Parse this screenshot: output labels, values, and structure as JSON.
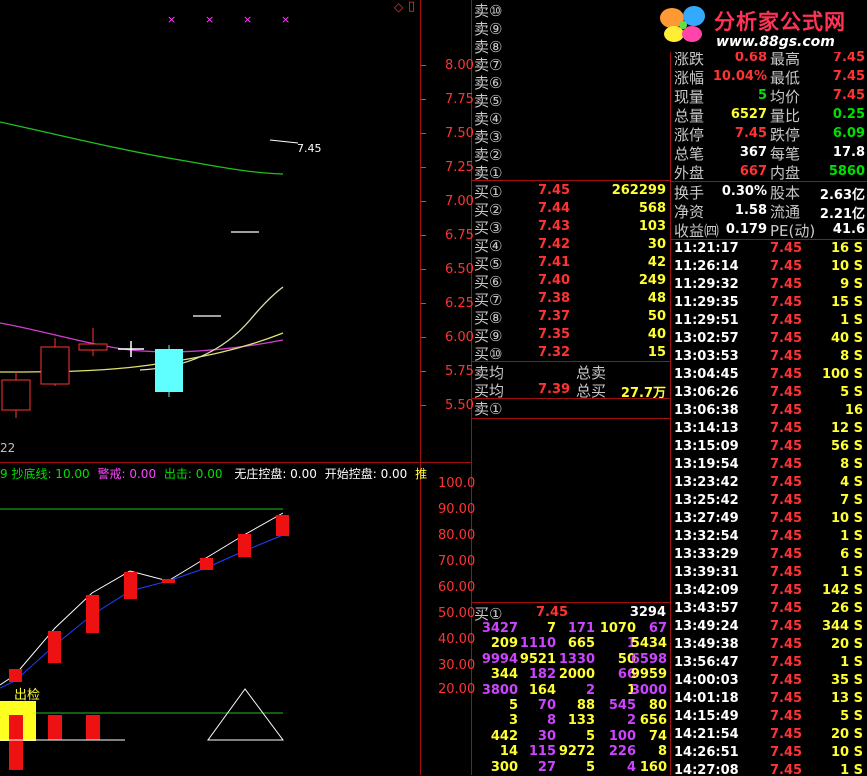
{
  "logo": {
    "title": "分析家公式网",
    "url": "www.88gs.com"
  },
  "chart_data": [
    {
      "type": "candlestick",
      "last_price_label": "7.45",
      "bottom_label": "22",
      "y_ticks": [
        "8.00",
        "7.75",
        "7.50",
        "7.25",
        "7.00",
        "6.75",
        "6.50",
        "6.25",
        "6.00",
        "5.75",
        "5.50"
      ],
      "marker_glyphs": [
        "×",
        "×",
        "×",
        "×"
      ],
      "top_symbols": [
        "◇",
        "▯"
      ]
    },
    {
      "type": "bar",
      "indicator_strip": [
        {
          "text": "9 抄底线: 10.00",
          "color": "#00e000"
        },
        {
          "text": "警戒: 0.00",
          "color": "#ff44ff"
        },
        {
          "text": "出击: 0.00",
          "color": "#00e000"
        },
        {
          "text": "无庄控盘: 0.00",
          "color": "#ffffff"
        },
        {
          "text": "开始控盘: 0.00",
          "color": "#ffffff"
        },
        {
          "text": "推",
          "color": "#ffff33"
        }
      ],
      "y_ticks": [
        "100.0",
        "90.00",
        "80.00",
        "70.00",
        "60.00",
        "50.00",
        "40.00",
        "30.00",
        "20.00"
      ],
      "annotation": "出检"
    }
  ],
  "sell_orders": [
    {
      "label": "卖⑩"
    },
    {
      "label": "卖⑨"
    },
    {
      "label": "卖⑧"
    },
    {
      "label": "卖⑦"
    },
    {
      "label": "卖⑥"
    },
    {
      "label": "卖⑤"
    },
    {
      "label": "卖④"
    },
    {
      "label": "卖③"
    },
    {
      "label": "卖②"
    },
    {
      "label": "卖①"
    }
  ],
  "buy_orders": [
    {
      "label": "买①",
      "price": "7.45",
      "vol": "262299"
    },
    {
      "label": "买②",
      "price": "7.44",
      "vol": "568"
    },
    {
      "label": "买③",
      "price": "7.43",
      "vol": "103"
    },
    {
      "label": "买④",
      "price": "7.42",
      "vol": "30"
    },
    {
      "label": "买⑤",
      "price": "7.41",
      "vol": "42"
    },
    {
      "label": "买⑥",
      "price": "7.40",
      "vol": "249"
    },
    {
      "label": "买⑦",
      "price": "7.38",
      "vol": "48"
    },
    {
      "label": "买⑧",
      "price": "7.37",
      "vol": "50"
    },
    {
      "label": "买⑨",
      "price": "7.35",
      "vol": "40"
    },
    {
      "label": "买⑩",
      "price": "7.32",
      "vol": "15"
    }
  ],
  "averages": {
    "sell_avg_label": "卖均",
    "total_sell_label": "总卖",
    "buy_avg_label": "买均",
    "buy_avg": "7.39",
    "total_buy_label": "总买",
    "total_buy": "27.7万",
    "sell1_label": "卖①"
  },
  "queue": {
    "label": "买①",
    "price": "7.45",
    "vol": "3294",
    "rows": [
      [
        "3427",
        "7",
        "171",
        "1070",
        "67"
      ],
      [
        "209",
        "1110",
        "665",
        "1",
        "5434"
      ],
      [
        "9994",
        "9521",
        "1330",
        "50",
        "6598"
      ],
      [
        "344",
        "182",
        "2000",
        "66",
        "9959"
      ],
      [
        "3800",
        "164",
        "2",
        "1",
        "3000"
      ],
      [
        "5",
        "70",
        "88",
        "545",
        "80"
      ],
      [
        "3",
        "8",
        "133",
        "2",
        "656"
      ],
      [
        "442",
        "30",
        "5",
        "100",
        "74"
      ],
      [
        "14",
        "115",
        "9272",
        "226",
        "8"
      ],
      [
        "300",
        "27",
        "5",
        "4",
        "160"
      ]
    ]
  },
  "quote": [
    {
      "l1": "涨跌",
      "v1": "0.68",
      "l2": "最高",
      "v2": "7.45",
      "c1": "#ff3333",
      "c2": "#ff3333"
    },
    {
      "l1": "涨幅",
      "v1": "10.04%",
      "l2": "最低",
      "v2": "7.45",
      "c1": "#ff3333",
      "c2": "#ff3333"
    },
    {
      "l1": "现量",
      "v1": "5",
      "l2": "均价",
      "v2": "7.45",
      "c1": "#00e000",
      "c2": "#ff3333"
    },
    {
      "l1": "总量",
      "v1": "6527",
      "l2": "量比",
      "v2": "0.25",
      "c1": "#ffff33",
      "c2": "#00e000"
    },
    {
      "l1": "涨停",
      "v1": "7.45",
      "l2": "跌停",
      "v2": "6.09",
      "c1": "#ff3333",
      "c2": "#00e000"
    },
    {
      "l1": "总笔",
      "v1": "367",
      "l2": "每笔",
      "v2": "17.8",
      "c1": "#ffffff",
      "c2": "#ffffff"
    },
    {
      "l1": "外盘",
      "v1": "667",
      "l2": "内盘",
      "v2": "5860",
      "c1": "#ff3333",
      "c2": "#00e000"
    }
  ],
  "stats": [
    {
      "l1": "换手",
      "v1": "0.30%",
      "l2": "股本",
      "v2": "2.63亿"
    },
    {
      "l1": "净资",
      "v1": "1.58",
      "l2": "流通",
      "v2": "2.21亿"
    },
    {
      "l1": "收益㈣",
      "v1": "0.179",
      "l2": "PE(动)",
      "v2": "41.6"
    }
  ],
  "ticks": [
    {
      "t": "11:21:17",
      "p": "7.45",
      "v": "16 S"
    },
    {
      "t": "11:26:14",
      "p": "7.45",
      "v": "10 S"
    },
    {
      "t": "11:29:32",
      "p": "7.45",
      "v": "9 S"
    },
    {
      "t": "11:29:35",
      "p": "7.45",
      "v": "15 S"
    },
    {
      "t": "11:29:51",
      "p": "7.45",
      "v": "1 S"
    },
    {
      "t": "13:02:57",
      "p": "7.45",
      "v": "40 S"
    },
    {
      "t": "13:03:53",
      "p": "7.45",
      "v": "8 S"
    },
    {
      "t": "13:04:45",
      "p": "7.45",
      "v": "100 S"
    },
    {
      "t": "13:06:26",
      "p": "7.45",
      "v": "5 S"
    },
    {
      "t": "13:06:38",
      "p": "7.45",
      "v": "16"
    },
    {
      "t": "13:14:13",
      "p": "7.45",
      "v": "12 S"
    },
    {
      "t": "13:15:09",
      "p": "7.45",
      "v": "56 S"
    },
    {
      "t": "13:19:54",
      "p": "7.45",
      "v": "8 S"
    },
    {
      "t": "13:23:42",
      "p": "7.45",
      "v": "4 S"
    },
    {
      "t": "13:25:42",
      "p": "7.45",
      "v": "7 S"
    },
    {
      "t": "13:27:49",
      "p": "7.45",
      "v": "10 S"
    },
    {
      "t": "13:32:54",
      "p": "7.45",
      "v": "1 S"
    },
    {
      "t": "13:33:29",
      "p": "7.45",
      "v": "6 S"
    },
    {
      "t": "13:39:31",
      "p": "7.45",
      "v": "1 S"
    },
    {
      "t": "13:42:09",
      "p": "7.45",
      "v": "142 S"
    },
    {
      "t": "13:43:57",
      "p": "7.45",
      "v": "26 S"
    },
    {
      "t": "13:49:24",
      "p": "7.45",
      "v": "344 S"
    },
    {
      "t": "13:49:38",
      "p": "7.45",
      "v": "20 S"
    },
    {
      "t": "13:56:47",
      "p": "7.45",
      "v": "1 S"
    },
    {
      "t": "14:00:03",
      "p": "7.45",
      "v": "35 S"
    },
    {
      "t": "14:01:18",
      "p": "7.45",
      "v": "13 S"
    },
    {
      "t": "14:15:49",
      "p": "7.45",
      "v": "5 S"
    },
    {
      "t": "14:21:54",
      "p": "7.45",
      "v": "20 S"
    },
    {
      "t": "14:26:51",
      "p": "7.45",
      "v": "10 S"
    },
    {
      "t": "14:27:08",
      "p": "7.45",
      "v": "1 S"
    }
  ]
}
